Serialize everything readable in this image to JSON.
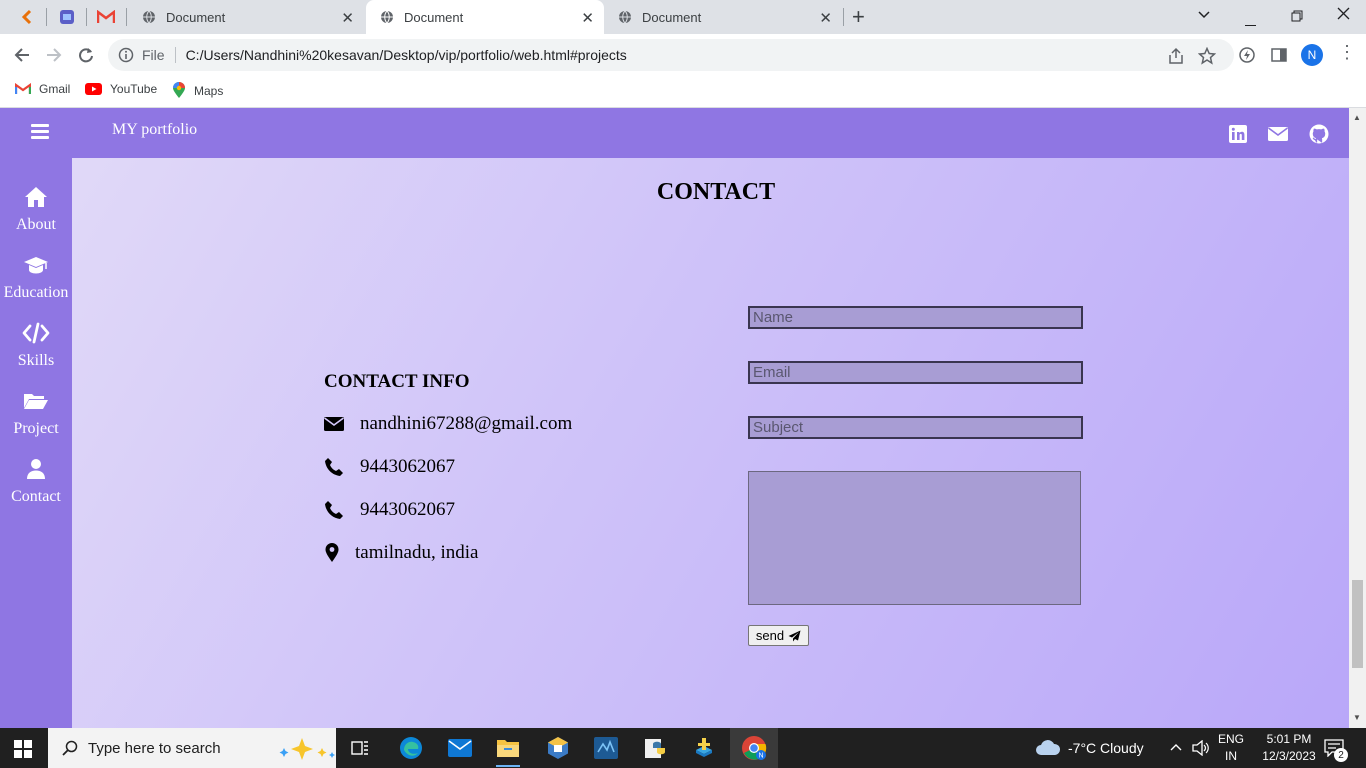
{
  "browser": {
    "tabs": [
      {
        "title": "Document",
        "active": false
      },
      {
        "title": "Document",
        "active": true
      },
      {
        "title": "Document",
        "active": false
      }
    ],
    "address": {
      "scheme_label": "File",
      "url": "C:/Users/Nandhini%20kesavan/Desktop/vip/portfolio/web.html#projects"
    },
    "profile_initial": "N",
    "bookmarks": [
      {
        "label": "Gmail",
        "icon": "gmail-icon"
      },
      {
        "label": "YouTube",
        "icon": "youtube-icon"
      },
      {
        "label": "Maps",
        "icon": "maps-icon"
      }
    ]
  },
  "page": {
    "brand": "MY portfolio",
    "sidebar": [
      {
        "label": "About",
        "icon": "home-icon"
      },
      {
        "label": "Education",
        "icon": "graduation-cap-icon"
      },
      {
        "label": "Skills",
        "icon": "code-icon"
      },
      {
        "label": "Project",
        "icon": "folder-open-icon"
      },
      {
        "label": "Contact",
        "icon": "user-icon"
      }
    ],
    "social_icons": [
      "linkedin-icon",
      "envelope-icon",
      "github-icon"
    ],
    "section_title": "CONTACT",
    "contact_info": {
      "title": "CONTACT INFO",
      "email": "nandhini67288@gmail.com",
      "phone1": "9443062067",
      "phone2": "9443062067",
      "location": "tamilnadu, india"
    },
    "form": {
      "name_placeholder": "Name",
      "email_placeholder": "Email",
      "subject_placeholder": "Subject",
      "message_value": "",
      "send_label": "send"
    }
  },
  "colors": {
    "nav_purple": "#8f76e3",
    "bg_gradient_start": "#e3dcf8",
    "bg_gradient_end": "#b9a7f9",
    "field_bg": "#a89dd4"
  },
  "taskbar": {
    "search_placeholder": "Type here to search",
    "weather": "-7°C  Cloudy",
    "lang_top": "ENG",
    "lang_bottom": "IN",
    "time": "5:01 PM",
    "date": "12/3/2023",
    "notification_count": "2"
  }
}
